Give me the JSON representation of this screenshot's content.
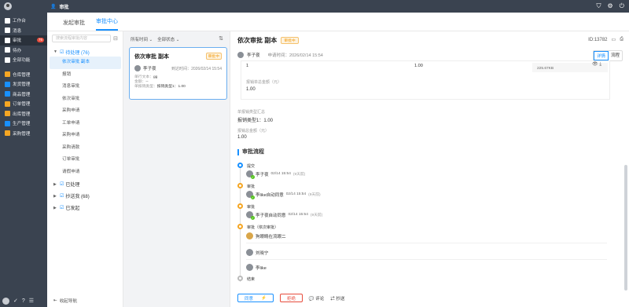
{
  "topbar": {
    "title": "审批",
    "icons": [
      "shield-icon",
      "gear-icon",
      "power-icon"
    ]
  },
  "sidebar": {
    "items": [
      {
        "label": "工作台",
        "icon": "desk-icon",
        "color": "#ffffff"
      },
      {
        "label": "消息",
        "icon": "message-icon",
        "color": "#ffffff"
      },
      {
        "label": "审批",
        "icon": "person-icon",
        "color": "#ffffff",
        "badge": "76",
        "active": true
      },
      {
        "label": "待办",
        "icon": "todo-icon",
        "color": "#ffffff"
      },
      {
        "label": "全部功能",
        "icon": "grid-icon",
        "color": "#ffffff"
      },
      {
        "label": "仓库管理",
        "icon": "warehouse-icon",
        "color": "#f5a623"
      },
      {
        "label": "发货管理",
        "icon": "ship-icon",
        "color": "#1890ff"
      },
      {
        "label": "商品管理",
        "icon": "goods-icon",
        "color": "#1890ff"
      },
      {
        "label": "订单管理",
        "icon": "order-icon",
        "color": "#f5a623"
      },
      {
        "label": "出库管理",
        "icon": "outbound-icon",
        "color": "#f5a623"
      },
      {
        "label": "生产管理",
        "icon": "factory-icon",
        "color": "#1890ff"
      },
      {
        "label": "采购管理",
        "icon": "purchase-icon",
        "color": "#f5a623"
      }
    ]
  },
  "tabs": [
    "发起审批",
    "审批中心"
  ],
  "nav": {
    "search_placeholder": "搜索流程审批内容",
    "pending_group": "待处理 (76)",
    "pending_items": [
      "依次审批 副本",
      "报销",
      "消息审批",
      "依次审批",
      "采购申请",
      "工单申请",
      "采购申请",
      "采购请款",
      "订单审批",
      "请假申请"
    ],
    "groups": [
      "已处理",
      "抄送我 (68)",
      "已发起"
    ],
    "footer": "收起导航"
  },
  "list": {
    "filters": [
      "所有时间",
      "全部状态"
    ],
    "card": {
      "title": "依次审批 副本",
      "tag": "审批中",
      "user": "李子夜",
      "time_label": "到达时间：",
      "time": "2026/02/14 15:54",
      "line1_label": "单行文本：",
      "line1_value": "gg",
      "line2_label": "金额：",
      "line2_value": "--",
      "line3_label": "单报销类型：",
      "line3_value": "报销类型1：1.00"
    }
  },
  "detail": {
    "title": "依次审批 副本",
    "tag": "审批中",
    "id": "ID:13782",
    "applicant": "李子夜",
    "apply_time_label": "申请时间：",
    "apply_time": "2026/02/14 15:54",
    "toggle": [
      "详情",
      "流程"
    ],
    "sub_cell1": "1",
    "sub_cell2": "1.00",
    "file_size": "225.67KB",
    "sub_total_label": "报销单总金额（元）",
    "sub_total": "1.00",
    "summary_label": "单报销类型汇总",
    "summary_value": "报销类型1：1.00",
    "total_label": "报销总金额（元）",
    "total_value": "1.00",
    "flow_title": "审批流程",
    "flow": {
      "n1": "提交",
      "n1_user": "李子夜",
      "n1_time": "02/14 15:54",
      "n1_state": "(9天前)",
      "n2": "审批",
      "n2_user": "李like自动同意",
      "n2_time": "02/14 15:54",
      "n2_state": "(9天前)",
      "n3": "审批",
      "n3_user": "李子夜自动同意",
      "n3_time": "02/14 15:54",
      "n3_state": "(9天前)",
      "n4": "审批（依次审批）",
      "n4_u1": "狗眼睛在流眼二",
      "n4_u2": "刘晓宁",
      "n4_u3": "李like",
      "n5": "结束"
    },
    "actions": {
      "agree": "同意",
      "reject": "拒绝",
      "comment": "评论",
      "cc": "抄送"
    }
  }
}
